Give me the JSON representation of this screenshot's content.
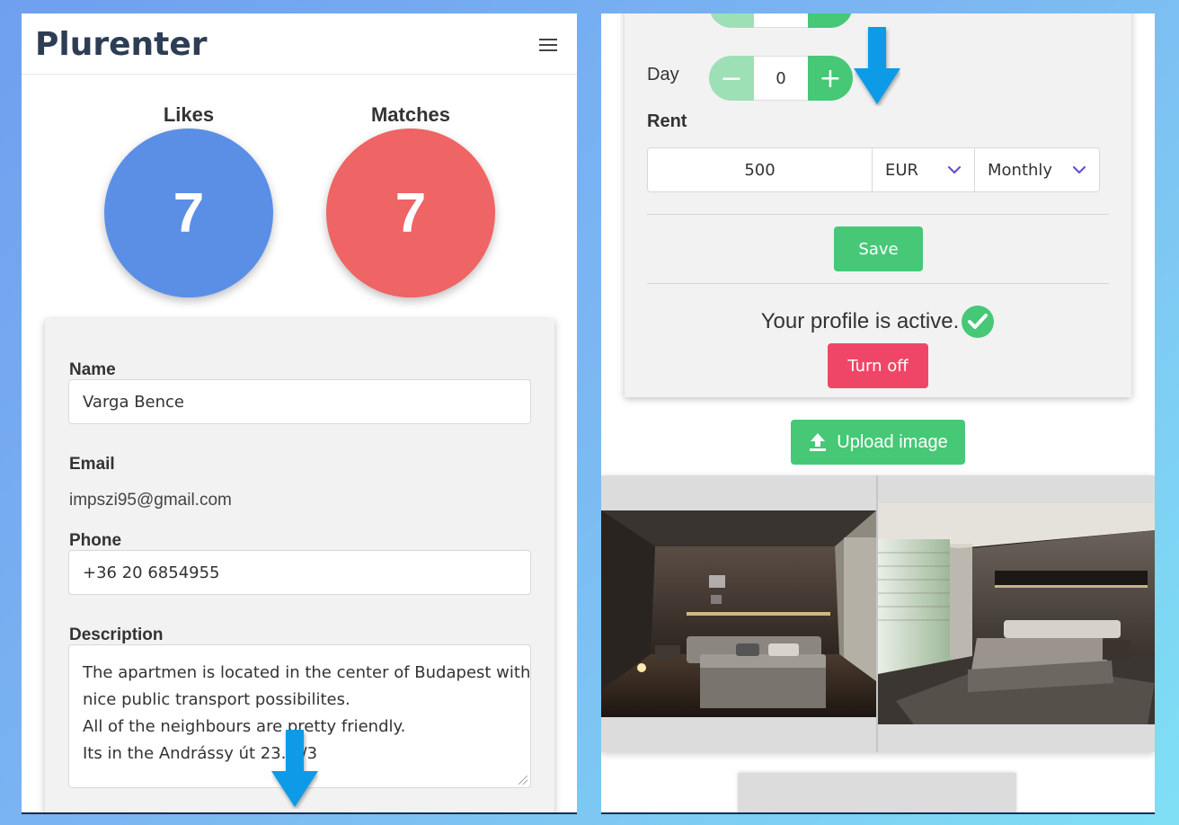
{
  "left_phone": {
    "brand": "Plurenter",
    "stats": {
      "likes_label": "Likes",
      "likes_count": "7",
      "matches_label": "Matches",
      "matches_count": "7"
    },
    "profile": {
      "name_label": "Name",
      "name_value": "Varga Bence",
      "email_label": "Email",
      "email_value": "impszi95@gmail.com",
      "phone_label": "Phone",
      "phone_value": "+36 20 6854955",
      "description_label": "Description",
      "description_lines": [
        "The apartmen is located in the center of Budapest with",
        "nice public transport possibilites.",
        "All of the neighbours are pretty friendly.",
        "Its in the Andrássy út 23. 1/3"
      ]
    }
  },
  "right_phone": {
    "day_label": "Day",
    "day_value": "0",
    "minus_symbol": "−",
    "plus_symbol": "+",
    "rent_label": "Rent",
    "rent_amount": "500",
    "currency": "EUR",
    "period": "Monthly",
    "save_label": "Save",
    "status_text": "Your profile is active.",
    "turn_off_label": "Turn off",
    "upload_label": "Upload image"
  },
  "colors": {
    "accent_green": "#46c877",
    "likes_blue": "#5b8fe6",
    "matches_red": "#ef6464",
    "danger_pink": "#ef4667",
    "annotation_arrow": "#0a9be8"
  }
}
